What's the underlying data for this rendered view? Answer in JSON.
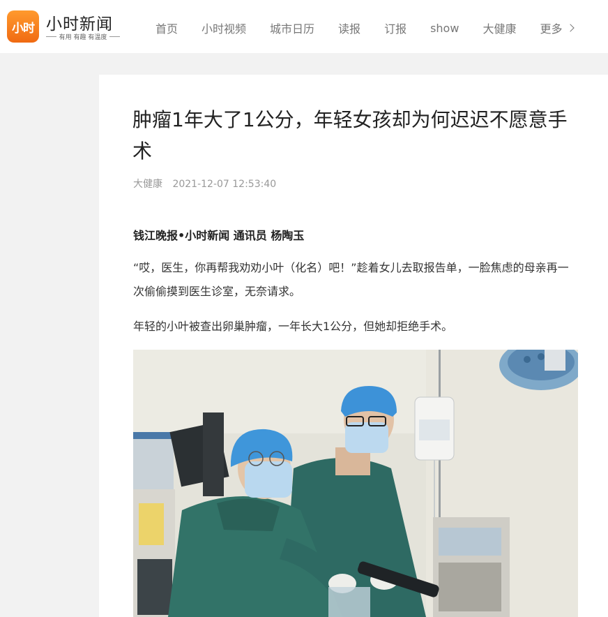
{
  "brand": {
    "logo_text": "小时",
    "name": "小时新闻",
    "slogan": "有用 有趣 有温度"
  },
  "nav": {
    "items": [
      "首页",
      "小时视频",
      "城市日历",
      "读报",
      "订报",
      "show",
      "大健康"
    ],
    "more_label": "更多"
  },
  "article": {
    "title": "肿瘤1年大了1公分，年轻女孩却为何迟迟不愿意手术",
    "category": "大健康",
    "datetime": "2021-12-07 12:53:40",
    "byline": "钱江晚报•小时新闻 通讯员 杨陶玉",
    "paragraphs": [
      "“哎，医生，你再帮我劝劝小叶（化名）吧！”趁着女儿去取报告单，一脸焦虑的母亲再一次偷偷摸到医生诊室，无奈请求。",
      "年轻的小叶被查出卵巢肿瘤，一年长大1公分，但她却拒绝手术。"
    ]
  },
  "colors": {
    "brand_orange": "#f07a1e",
    "page_bg": "#f2f2f2",
    "surgical_green": "#2f6f68",
    "surgical_cap_blue": "#3a8fd6"
  }
}
